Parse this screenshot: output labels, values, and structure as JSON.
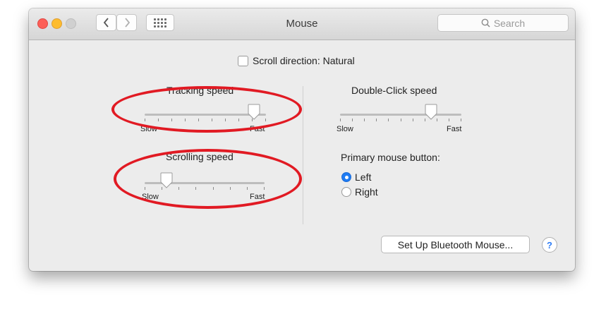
{
  "window": {
    "title": "Mouse"
  },
  "toolbar": {
    "back_icon": "chevron-left-icon",
    "forward_icon": "chevron-right-icon",
    "grid_icon": "grid-icon",
    "search_placeholder": "Search"
  },
  "scroll_direction": {
    "label": "Scroll direction: Natural",
    "checked": false
  },
  "tracking_speed": {
    "label": "Tracking speed",
    "min_label": "Slow",
    "max_label": "Fast",
    "value_fraction": 0.9
  },
  "scrolling_speed": {
    "label": "Scrolling speed",
    "min_label": "Slow",
    "max_label": "Fast",
    "value_fraction": 0.18
  },
  "double_click_speed": {
    "label": "Double-Click speed",
    "min_label": "Slow",
    "max_label": "Fast",
    "value_fraction": 0.75
  },
  "primary_button": {
    "label": "Primary mouse button:",
    "options": [
      {
        "label": "Left",
        "selected": true
      },
      {
        "label": "Right",
        "selected": false
      }
    ]
  },
  "bluetooth_button": {
    "label": "Set Up Bluetooth Mouse..."
  },
  "help_button": {
    "label": "?"
  },
  "colors": {
    "highlight": "#e11a23",
    "accent": "#1f7cf3"
  }
}
